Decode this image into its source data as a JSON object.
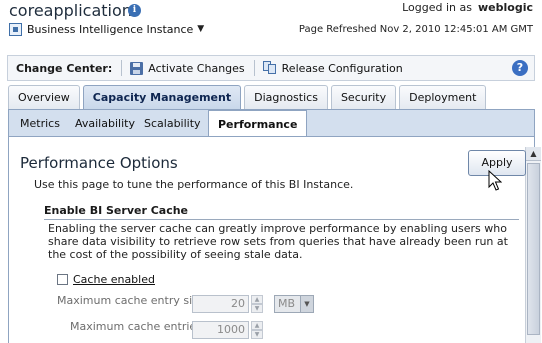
{
  "header": {
    "app_title": "coreapplication",
    "logged_in_prefix": "Logged in as",
    "username": "weblogic",
    "instance_label": "Business Intelligence Instance",
    "page_refreshed": "Page Refreshed Nov 2, 2010 12:45:01 AM GMT"
  },
  "change_center": {
    "label": "Change Center:",
    "activate_label": "Activate Changes",
    "release_label": "Release Configuration",
    "help": "?"
  },
  "tabs": [
    {
      "label": "Overview",
      "active": false
    },
    {
      "label": "Capacity Management",
      "active": true
    },
    {
      "label": "Diagnostics",
      "active": false
    },
    {
      "label": "Security",
      "active": false
    },
    {
      "label": "Deployment",
      "active": false
    }
  ],
  "subtabs": [
    {
      "label": "Metrics",
      "active": false
    },
    {
      "label": "Availability",
      "active": false
    },
    {
      "label": "Scalability",
      "active": false
    },
    {
      "label": "Performance",
      "active": true
    }
  ],
  "performance": {
    "title": "Performance Options",
    "description": "Use this page to tune the performance of this BI Instance.",
    "apply_label": "Apply",
    "cache_section": {
      "heading": "Enable BI Server Cache",
      "description": "Enabling the server cache can greatly improve performance by enabling users who share data visibility to retrieve row sets from queries that have already been run at the cost of the possibility of seeing stale data.",
      "cache_enabled_label": "Cache enabled",
      "cache_enabled": false,
      "max_entry_size_label": "Maximum cache entry size",
      "max_entry_size_value": "20",
      "max_entry_size_unit": "MB",
      "max_entries_label": "Maximum cache entries",
      "max_entries_value": "1000"
    }
  },
  "colors": {
    "accent": "#3b6fc2",
    "tab_active_bg": "#c8d7ea",
    "subtab_bar_bg": "#d3dfee"
  }
}
